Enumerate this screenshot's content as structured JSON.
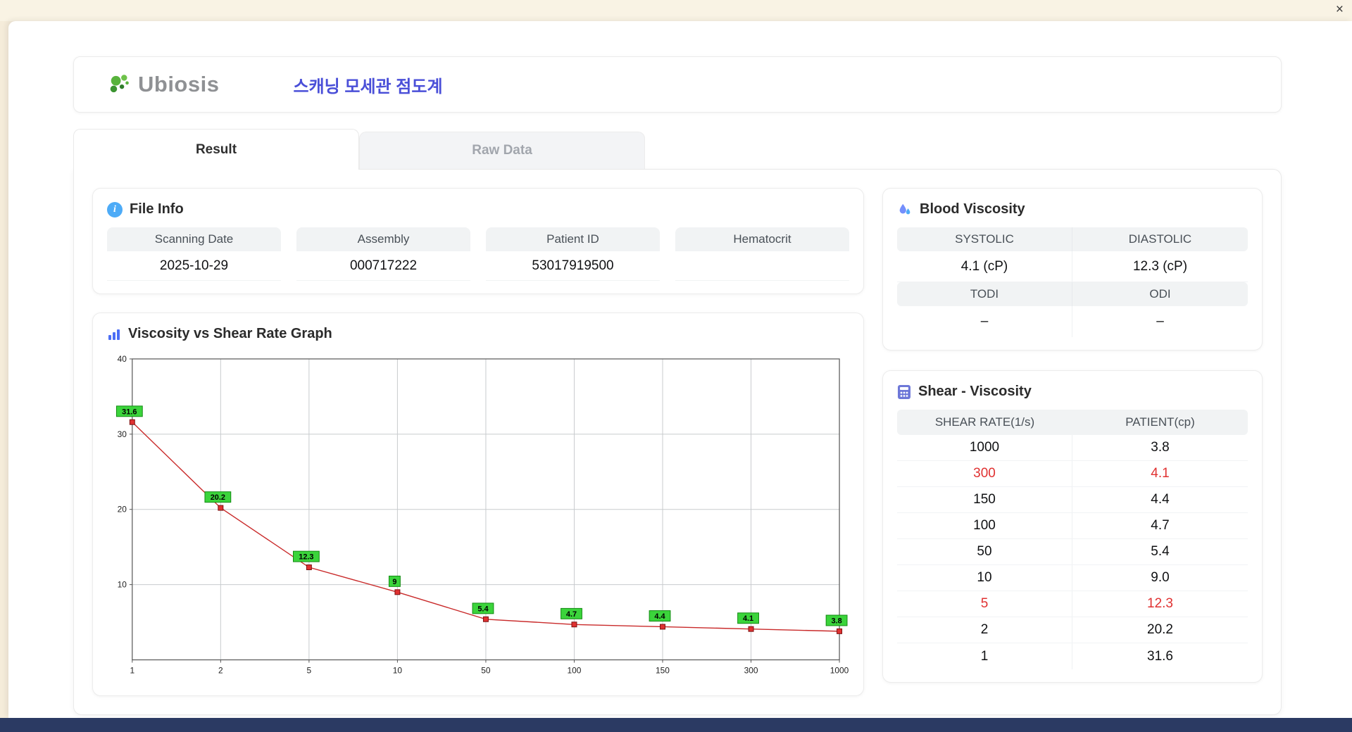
{
  "window": {
    "close_label": "×"
  },
  "header": {
    "logo_text": "Ubiosis",
    "app_title": "스캐닝 모세관 점도계"
  },
  "tabs": [
    {
      "label": "Result",
      "active": true
    },
    {
      "label": "Raw Data",
      "active": false
    }
  ],
  "file_info": {
    "title": "File Info",
    "fields": [
      {
        "label": "Scanning Date",
        "value": "2025-10-29"
      },
      {
        "label": "Assembly",
        "value": "000717222"
      },
      {
        "label": "Patient ID",
        "value": "53017919500"
      },
      {
        "label": "Hematocrit",
        "value": ""
      }
    ]
  },
  "graph": {
    "title": "Viscosity vs Shear Rate Graph"
  },
  "chart_data": {
    "type": "line",
    "title": "Viscosity vs Shear Rate Graph",
    "categories": [
      "1",
      "2",
      "5",
      "10",
      "50",
      "100",
      "150",
      "300",
      "1000"
    ],
    "values": [
      31.6,
      20.2,
      12.3,
      9,
      5.4,
      4.7,
      4.4,
      4.1,
      3.8
    ],
    "point_labels": [
      "31.6",
      "20.2",
      "12.3",
      "9",
      "5.4",
      "4.7",
      "4.4",
      "4.1",
      "3.8"
    ],
    "ylim": [
      0,
      40
    ],
    "yticks": [
      10,
      20,
      30,
      40
    ],
    "xlabel": "",
    "ylabel": "",
    "grid": true,
    "line_color": "#c92a2a",
    "marker_color": "#e03131",
    "marker_edge": "#7a1010",
    "label_bg": "#3bd43b",
    "label_edge": "#128a12",
    "grid_color": "#c8cbce",
    "axis_color": "#555555"
  },
  "blood_viscosity": {
    "title": "Blood Viscosity",
    "rows": [
      {
        "labels": [
          "SYSTOLIC",
          "DIASTOLIC"
        ],
        "values": [
          "4.1 (cP)",
          "12.3 (cP)"
        ]
      },
      {
        "labels": [
          "TODI",
          "ODI"
        ],
        "values": [
          "–",
          "–"
        ]
      }
    ]
  },
  "shear_viscosity": {
    "title": "Shear - Viscosity",
    "columns": [
      "SHEAR RATE(1/s)",
      "PATIENT(cp)"
    ],
    "highlight_color": "#e03131",
    "rows": [
      {
        "rate": "1000",
        "patient": "3.8",
        "highlight": false
      },
      {
        "rate": "300",
        "patient": "4.1",
        "highlight": true
      },
      {
        "rate": "150",
        "patient": "4.4",
        "highlight": false
      },
      {
        "rate": "100",
        "patient": "4.7",
        "highlight": false
      },
      {
        "rate": "50",
        "patient": "5.4",
        "highlight": false
      },
      {
        "rate": "10",
        "patient": "9.0",
        "highlight": false
      },
      {
        "rate": "5",
        "patient": "12.3",
        "highlight": true
      },
      {
        "rate": "2",
        "patient": "20.2",
        "highlight": false
      },
      {
        "rate": "1",
        "patient": "31.6",
        "highlight": false
      }
    ]
  }
}
